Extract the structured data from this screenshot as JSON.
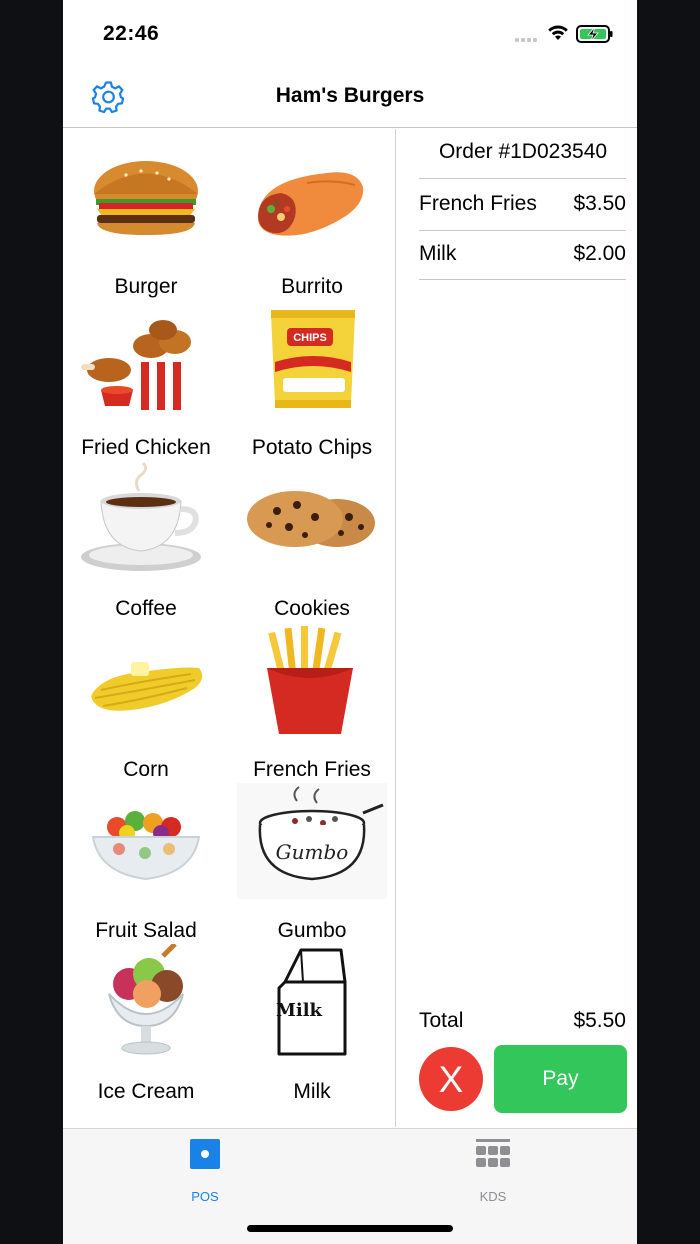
{
  "status_bar": {
    "time": "22:46",
    "icons": [
      "signal-icon",
      "wifi-icon",
      "battery-charging-icon"
    ]
  },
  "header": {
    "title": "Ham's Burgers",
    "settings_icon": "gear-icon"
  },
  "menu": {
    "items": [
      {
        "label": "Burger",
        "icon": "burger-image"
      },
      {
        "label": "Burrito",
        "icon": "burrito-image"
      },
      {
        "label": "Fried Chicken",
        "icon": "fried-chicken-image"
      },
      {
        "label": "Potato Chips",
        "icon": "potato-chips-image"
      },
      {
        "label": "Coffee",
        "icon": "coffee-image"
      },
      {
        "label": "Cookies",
        "icon": "cookies-image"
      },
      {
        "label": "Corn",
        "icon": "corn-image"
      },
      {
        "label": "French Fries",
        "icon": "french-fries-image"
      },
      {
        "label": "Fruit Salad",
        "icon": "fruit-salad-image"
      },
      {
        "label": "Gumbo",
        "icon": "gumbo-image",
        "image_text": "Gumbo"
      },
      {
        "label": "Ice Cream",
        "icon": "ice-cream-image"
      },
      {
        "label": "Milk",
        "icon": "milk-image",
        "image_text": "Milk"
      }
    ]
  },
  "order": {
    "number": "Order #1D023540",
    "lines": [
      {
        "name": "French Fries",
        "price": "$3.50"
      },
      {
        "name": "Milk",
        "price": "$2.00"
      }
    ],
    "total_label": "Total",
    "total_value": "$5.50",
    "cancel_label": "X",
    "pay_label": "Pay"
  },
  "tabs": [
    {
      "label": "POS",
      "icon": "pos-icon",
      "active": true
    },
    {
      "label": "KDS",
      "icon": "kds-grid-icon",
      "active": false
    }
  ],
  "colors": {
    "accent": "#1a82e6",
    "pay": "#33c65a",
    "cancel": "#ec3b33",
    "tab_inactive": "#8e8e93"
  }
}
